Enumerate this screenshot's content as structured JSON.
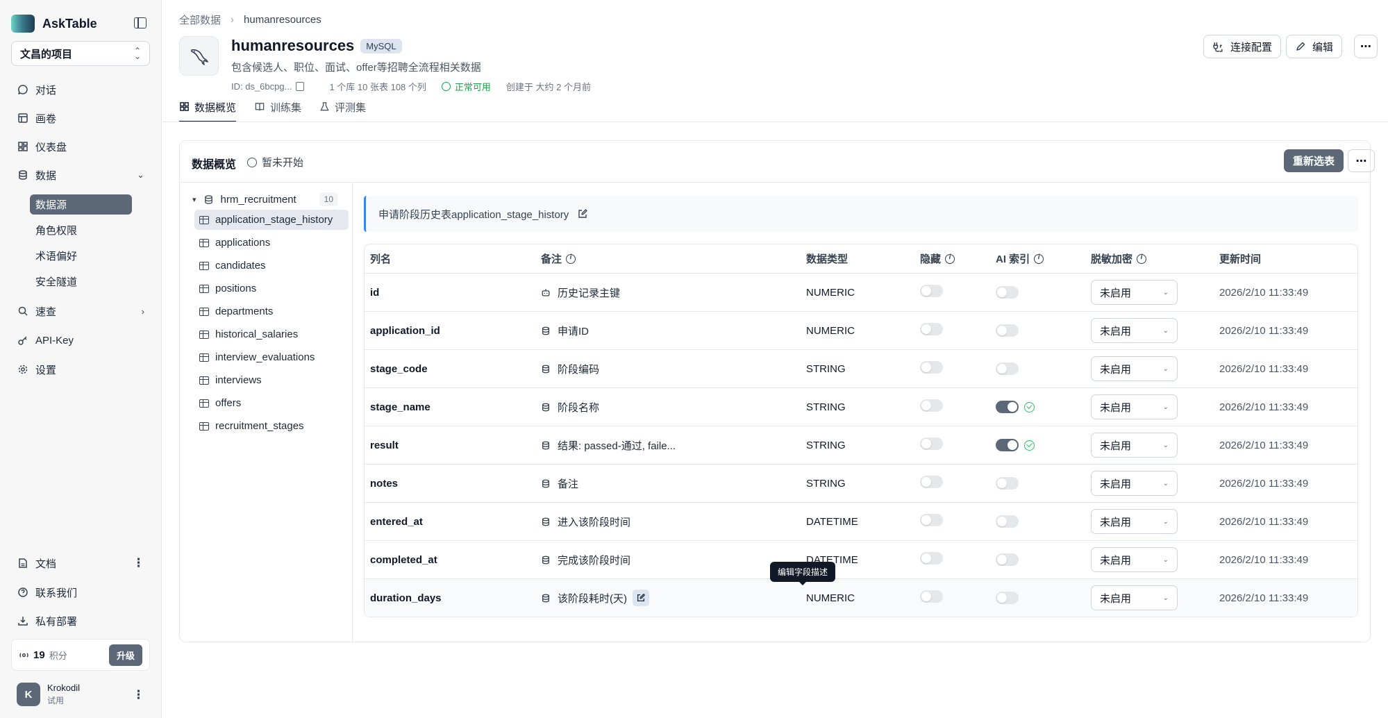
{
  "app": {
    "name": "AskTable",
    "project": "文昌的项目"
  },
  "sidebar": {
    "nav": [
      {
        "label": "对话",
        "icon": "chat-icon"
      },
      {
        "label": "画卷",
        "icon": "canvas-icon"
      },
      {
        "label": "仪表盘",
        "icon": "dashboard-icon"
      },
      {
        "label": "数据",
        "icon": "database-icon"
      }
    ],
    "data_sub": [
      "数据源",
      "角色权限",
      "术语偏好",
      "安全隧道"
    ],
    "nav_more": [
      {
        "label": "速查",
        "icon": "search-icon"
      },
      {
        "label": "API-Key",
        "icon": "key-icon"
      },
      {
        "label": "设置",
        "icon": "gear-icon"
      }
    ],
    "bottom": [
      {
        "label": "文档",
        "icon": "doc-icon"
      },
      {
        "label": "联系我们",
        "icon": "help-icon"
      },
      {
        "label": "私有部署",
        "icon": "download-icon"
      }
    ],
    "credits": {
      "value": "19",
      "unit": "积分",
      "upgrade": "升级"
    },
    "user": {
      "initial": "K",
      "name": "Krokodil",
      "plan": "试用"
    }
  },
  "breadcrumb": {
    "root": "全部数据",
    "current": "humanresources"
  },
  "datasource": {
    "name": "humanresources",
    "engine": "MySQL",
    "description": "包含候选人、职位、面试、offer等招聘全流程相关数据",
    "id": "ID: ds_6bcpg...",
    "stats": "1 个库 10 张表 108 个列",
    "status": "正常可用",
    "created": "创建于 大约 2 个月前"
  },
  "header_actions": {
    "connect": "连接配置",
    "edit": "编辑"
  },
  "tabs": [
    "数据概览",
    "训练集",
    "评测集"
  ],
  "overview": {
    "title": "数据概览",
    "status": "暂未开始",
    "reselect": "重新选表"
  },
  "tree": {
    "schema": "hrm_recruitment",
    "count": "10",
    "tables": [
      "application_stage_history",
      "applications",
      "candidates",
      "positions",
      "departments",
      "historical_salaries",
      "interview_evaluations",
      "interviews",
      "offers",
      "recruitment_stages"
    ]
  },
  "table_desc": "申请阶段历史表application_stage_history",
  "columns_header": {
    "name": "列名",
    "remark": "备注",
    "type": "数据类型",
    "hidden": "隐藏",
    "ai_index": "AI 索引",
    "mask": "脱敏加密",
    "updated": "更新时间"
  },
  "columns": [
    {
      "name": "id",
      "remark": "历史记录主键",
      "type": "NUMERIC",
      "hidden": false,
      "ai_index": false,
      "mask": "未启用",
      "updated": "2026/2/10 11:33:49",
      "remark_icon": "robot-icon"
    },
    {
      "name": "application_id",
      "remark": "申请ID",
      "type": "NUMERIC",
      "hidden": false,
      "ai_index": false,
      "mask": "未启用",
      "updated": "2026/2/10 11:33:49",
      "remark_icon": "database-icon"
    },
    {
      "name": "stage_code",
      "remark": "阶段编码",
      "type": "STRING",
      "hidden": false,
      "ai_index": false,
      "mask": "未启用",
      "updated": "2026/2/10 11:33:49",
      "remark_icon": "database-icon"
    },
    {
      "name": "stage_name",
      "remark": "阶段名称",
      "type": "STRING",
      "hidden": false,
      "ai_index": true,
      "mask": "未启用",
      "updated": "2026/2/10 11:33:49",
      "remark_icon": "database-icon"
    },
    {
      "name": "result",
      "remark": "结果: passed-通过, faile...",
      "type": "STRING",
      "hidden": false,
      "ai_index": true,
      "mask": "未启用",
      "updated": "2026/2/10 11:33:49",
      "remark_icon": "database-icon"
    },
    {
      "name": "notes",
      "remark": "备注",
      "type": "STRING",
      "hidden": false,
      "ai_index": false,
      "mask": "未启用",
      "updated": "2026/2/10 11:33:49",
      "remark_icon": "database-icon"
    },
    {
      "name": "entered_at",
      "remark": "进入该阶段时间",
      "type": "DATETIME",
      "hidden": false,
      "ai_index": false,
      "mask": "未启用",
      "updated": "2026/2/10 11:33:49",
      "remark_icon": "database-icon"
    },
    {
      "name": "completed_at",
      "remark": "完成该阶段时间",
      "type": "DATETIME",
      "hidden": false,
      "ai_index": false,
      "mask": "未启用",
      "updated": "2026/2/10 11:33:49",
      "remark_icon": "database-icon"
    },
    {
      "name": "duration_days",
      "remark": "该阶段耗时(天)",
      "type": "NUMERIC",
      "hidden": false,
      "ai_index": false,
      "mask": "未启用",
      "updated": "2026/2/10 11:33:49",
      "remark_icon": "database-icon"
    }
  ],
  "tooltip": "编辑字段描述"
}
